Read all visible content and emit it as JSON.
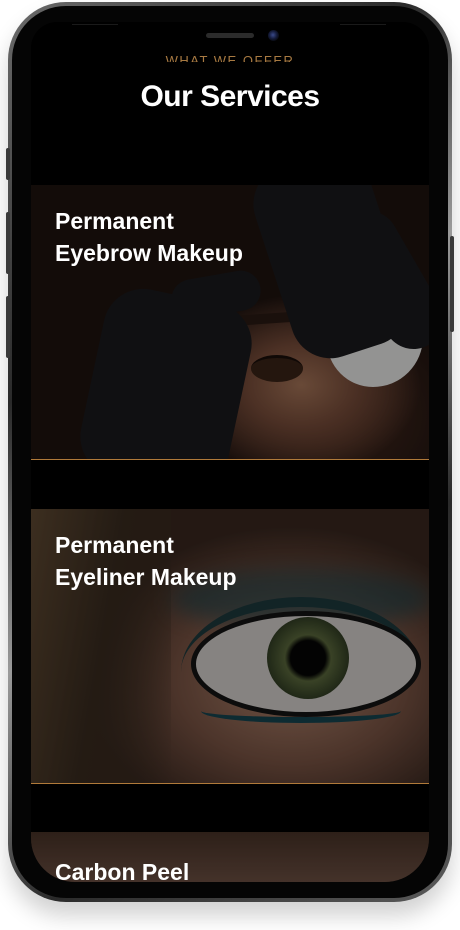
{
  "section": {
    "kicker": "WHAT WE OFFER",
    "title": "Our Services"
  },
  "services": [
    {
      "title": "Permanent Eyebrow Makeup",
      "image": "eyebrow-procedure-photo"
    },
    {
      "title": "Permanent Eyeliner Makeup",
      "image": "eye-closeup-photo"
    },
    {
      "title": "Carbon Peel",
      "image": "carbon-peel-photo"
    }
  ],
  "colors": {
    "accent": "#b07a3a",
    "kicker": "#a87a42",
    "background": "#000000",
    "text": "#ffffff"
  }
}
